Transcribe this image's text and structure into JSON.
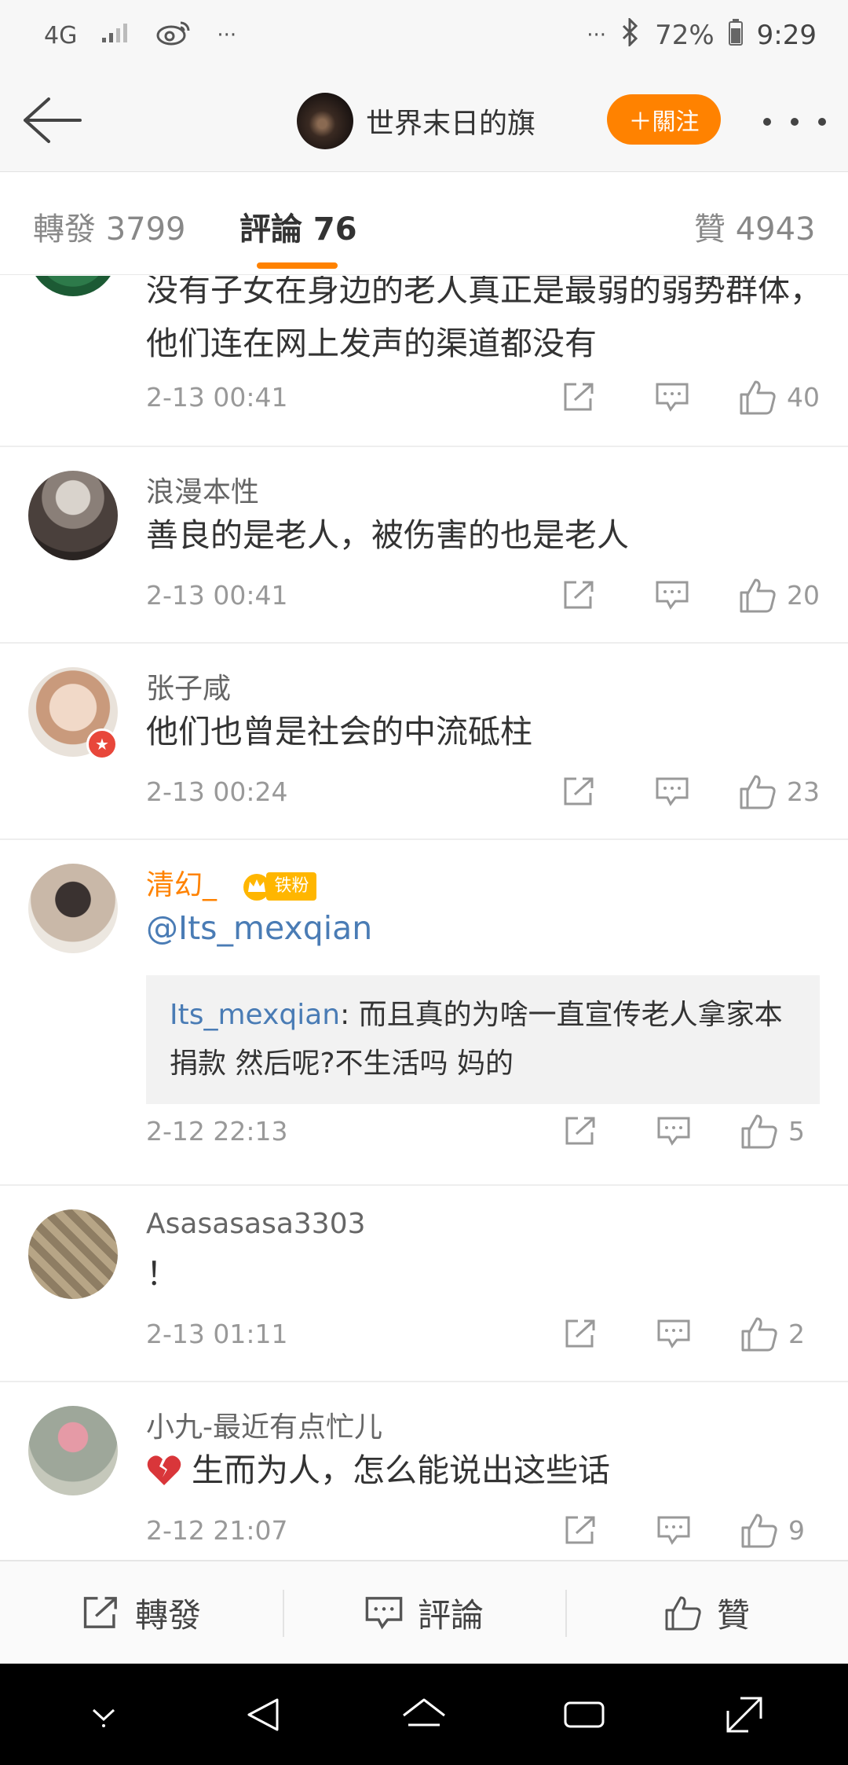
{
  "status_bar": {
    "network": "4G",
    "more": "···",
    "more_right": "···",
    "battery": "72%",
    "time": "9:29"
  },
  "header": {
    "title": "世界末日的旗",
    "follow_label": "＋關注"
  },
  "tabs": {
    "repost": "轉發 3799",
    "comments": "評論 76",
    "likes": "贊 4943"
  },
  "comments": [
    {
      "text": "没有子女在身边的老人真正是最弱的弱势群体，他们连在网上发声的渠道都没有",
      "time": "2-13 00:41",
      "likes": "40"
    },
    {
      "name": "浪漫本性",
      "text": "善良的是老人，被伤害的也是老人",
      "time": "2-13 00:41",
      "likes": "20"
    },
    {
      "name": "张子咸",
      "text": "他们也曾是社会的中流砥柱",
      "time": "2-13 00:24",
      "likes": "23"
    },
    {
      "name": "清幻_",
      "badge": "铁粉",
      "text": "@Its_mexqian",
      "quote_name": "Its_mexqian",
      "quote_text": ": 而且真的为啥一直宣传老人拿家本捐款  然后呢?不生活吗  妈的",
      "time": "2-12 22:13",
      "likes": "5"
    },
    {
      "name": "Asasasasa3303",
      "text": "！",
      "time": "2-13 01:11",
      "likes": "2"
    },
    {
      "name": "小九-最近有点忙儿",
      "text": "生而为人，怎么能说出这些话",
      "time": "2-12 21:07",
      "likes": "9"
    }
  ],
  "bottom_bar": {
    "repost": "轉發",
    "comment": "評論",
    "like": "贊"
  },
  "colors": {
    "accent": "#ff8200",
    "link": "#4a7cb5"
  }
}
